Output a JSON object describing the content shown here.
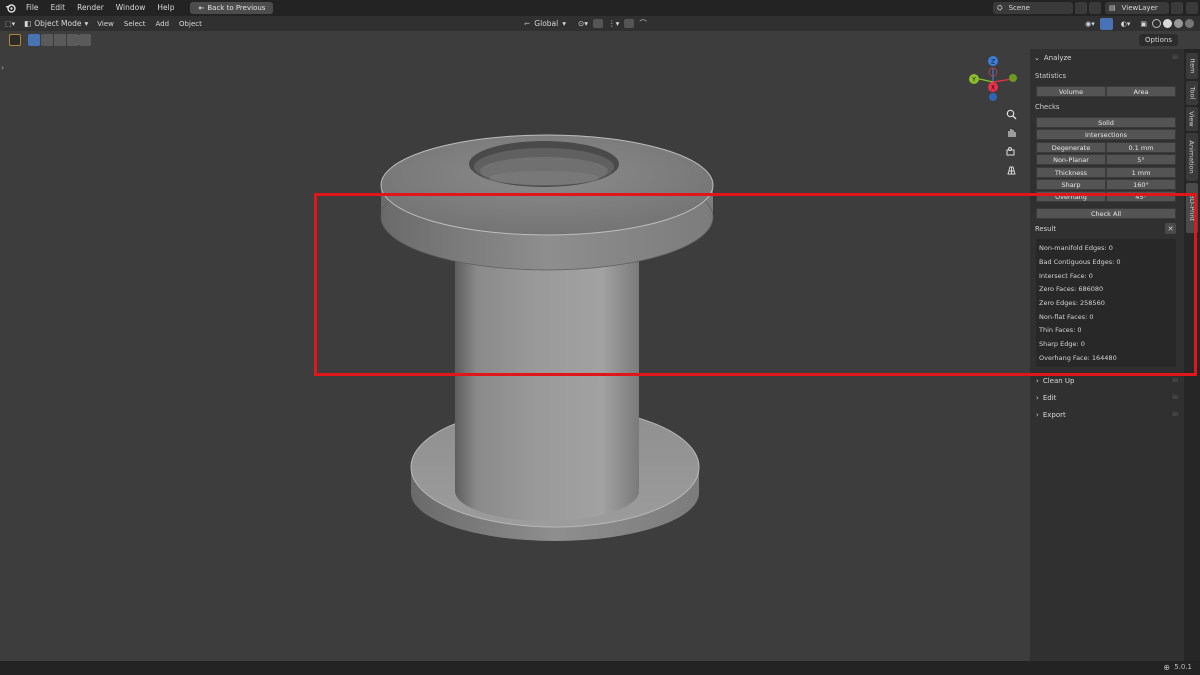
{
  "topbar": {
    "menus": [
      "File",
      "Edit",
      "Render",
      "Window",
      "Help"
    ],
    "back_label": "Back to Previous",
    "scene_label": "Scene",
    "view_layer_label": "ViewLayer"
  },
  "header": {
    "mode_label": "Object Mode",
    "menus": [
      "View",
      "Select",
      "Add",
      "Object"
    ],
    "transform_orientation": "Global"
  },
  "toolrow": {
    "options_label": "Options"
  },
  "gizmo": {
    "axis_y": "Y",
    "axis_x": "X",
    "axis_z": "Z",
    "colors": {
      "x": "#e8304a",
      "y": "#8bbf2a",
      "z": "#3b7ed8"
    }
  },
  "panel": {
    "analyze_title": "Analyze",
    "statistics_label": "Statistics",
    "volume_btn": "Volume",
    "area_btn": "Area",
    "checks_label": "Checks",
    "solid_btn": "Solid",
    "intersections_btn": "Intersections",
    "checks": [
      {
        "label": "Degenerate",
        "value": "0.1 mm"
      },
      {
        "label": "Non-Planar",
        "value": "5°"
      },
      {
        "label": "Thickness",
        "value": "1 mm"
      },
      {
        "label": "Sharp",
        "value": "160°"
      },
      {
        "label": "Overhang",
        "value": "45°"
      }
    ],
    "check_all_btn": "Check All",
    "result_label": "Result",
    "results": [
      "Non-manifold Edges: 0",
      "Bad Contiguous Edges: 0",
      "Intersect Face: 0",
      "Zero Faces: 686080",
      "Zero Edges: 258560",
      "Non-flat Faces: 0",
      "Thin Faces: 0",
      "Sharp Edge: 0",
      "Overhang Face: 164480"
    ],
    "cleanup_label": "Clean Up",
    "edit_label": "Edit",
    "export_label": "Export"
  },
  "tabs": [
    "Item",
    "Tool",
    "View",
    "Animation",
    "3D-Print"
  ],
  "status": {
    "version": "5.0.1"
  },
  "colors": {
    "highlight": "#e0161b",
    "accent_blue": "#4772b3"
  }
}
